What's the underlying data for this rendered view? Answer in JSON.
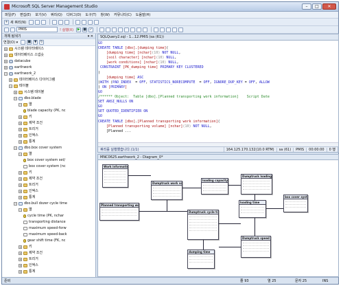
{
  "window": {
    "title": "Microsoft SQL Server Management Studio"
  },
  "menu": [
    "파일(F)",
    "편집(E)",
    "보기(V)",
    "쿼리(Q)",
    "디버그(D)",
    "도구(T)",
    "창(W)",
    "커뮤니티(C)",
    "도움말(H)"
  ],
  "toolbar1": {
    "new_query": "새 쿼리(N)"
  },
  "toolbar2": {
    "database": "PMIS",
    "execute": "! 실행(X)"
  },
  "object_explorer": {
    "title": "개체 탐색기",
    "connect": "연결(O) ▾",
    "tree": [
      {
        "label": "시스템 데이터베이스",
        "depth": 1,
        "icon": "folder"
      },
      {
        "label": "데이터베이스 스냅숏",
        "depth": 1,
        "icon": "folder"
      },
      {
        "label": "datacube",
        "depth": 1,
        "icon": "db"
      },
      {
        "label": "earthwork",
        "depth": 1,
        "icon": "db"
      },
      {
        "label": "earthwork_2",
        "depth": 1,
        "icon": "db"
      },
      {
        "label": "데이터베이스 다이어그램",
        "depth": 2,
        "icon": "folder"
      },
      {
        "label": "테이블",
        "depth": 2,
        "icon": "folder"
      },
      {
        "label": "시스템 테이블",
        "depth": 3,
        "icon": "folder"
      },
      {
        "label": "dbo.blade",
        "depth": 3,
        "icon": "table"
      },
      {
        "label": "열",
        "depth": 4,
        "icon": "folder"
      },
      {
        "label": "blade capacity (PK, nc",
        "depth": 5,
        "icon": "key"
      },
      {
        "label": "키",
        "depth": 4,
        "icon": "folder"
      },
      {
        "label": "제약 조건",
        "depth": 4,
        "icon": "folder"
      },
      {
        "label": "트리거",
        "depth": 4,
        "icon": "folder"
      },
      {
        "label": "인덱스",
        "depth": 4,
        "icon": "folder"
      },
      {
        "label": "통계",
        "depth": 4,
        "icon": "folder"
      },
      {
        "label": "dbo.box cover system",
        "depth": 3,
        "icon": "table"
      },
      {
        "label": "열",
        "depth": 4,
        "icon": "folder"
      },
      {
        "label": "box cover system set/",
        "depth": 5,
        "icon": "key"
      },
      {
        "label": "box cover system (nc",
        "depth": 5,
        "icon": "col"
      },
      {
        "label": "키",
        "depth": 4,
        "icon": "folder"
      },
      {
        "label": "제약 조건",
        "depth": 4,
        "icon": "folder"
      },
      {
        "label": "트리거",
        "depth": 4,
        "icon": "folder"
      },
      {
        "label": "인덱스",
        "depth": 4,
        "icon": "folder"
      },
      {
        "label": "통계",
        "depth": 4,
        "icon": "folder"
      },
      {
        "label": "dbo.bull dozer cycle time",
        "depth": 3,
        "icon": "table"
      },
      {
        "label": "열",
        "depth": 4,
        "icon": "folder"
      },
      {
        "label": "cycle time (PK, nchar",
        "depth": 5,
        "icon": "key"
      },
      {
        "label": "transporting distance",
        "depth": 5,
        "icon": "col"
      },
      {
        "label": "maximum speed-forw",
        "depth": 5,
        "icon": "col"
      },
      {
        "label": "maximum speed-back",
        "depth": 5,
        "icon": "col"
      },
      {
        "label": "gear shift time (FK, nc",
        "depth": 5,
        "icon": "key"
      },
      {
        "label": "키",
        "depth": 4,
        "icon": "folder"
      },
      {
        "label": "제약 조건",
        "depth": 4,
        "icon": "folder"
      },
      {
        "label": "트리거",
        "depth": 4,
        "icon": "folder"
      },
      {
        "label": "인덱스",
        "depth": 4,
        "icon": "folder"
      },
      {
        "label": "통계",
        "depth": 4,
        "icon": "folder"
      }
    ]
  },
  "editor": {
    "tab": "SQLQuery2.sql - 1...12.PMIS (sa (61))",
    "lines": [
      "GO",
      "CREATE TABLE [dbo].[dumping time](",
      "    [dumping time] [nchar](10) NOT NULL,",
      "    [soil character] [nchar](10) NULL,",
      "    [work conditions] [nchar](10) NULL,",
      " CONSTRAINT [PK_dumping time] PRIMARY KEY CLUSTERED",
      "(",
      "    [dumping time] ASC",
      ")WITH (PAD_INDEX  = OFF, STATISTICS_NORECOMPUTE  = OFF, IGNORE_DUP_KEY = OFF, ALLOW",
      ") ON [PRIMARY]",
      "GO",
      "/****** Object:  Table [dbo].[Planned transporting work information]    Script Date",
      "SET ANSI_NULLS ON",
      "GO",
      "SET QUOTED_IDENTIFIER ON",
      "GO",
      "CREATE TABLE [dbo].[Planned transporting work information](",
      "    [Planned transporting volume] [nchar](10) NOT NULL,",
      "    [Planned ..."
    ],
    "status": {
      "msg": "쿼리를 실행했습니다.(1/1)",
      "server": "164.125.170.132(10.0 RTM)",
      "user": "sa (61)",
      "db": "PMIS",
      "time": "00:00:00",
      "rows": "0 행"
    }
  },
  "diagram": {
    "tab": "MNC0625.earthwork_2 - Diagram_0*",
    "tables": [
      {
        "name": "Work information",
        "rows": 5
      },
      {
        "name": "Dumptruck work volume p",
        "rows": 4
      },
      {
        "name": "loading capacity",
        "rows": 3
      },
      {
        "name": "Dumptruck loading c",
        "rows": 4
      },
      {
        "name": "Planned transporting work infor",
        "rows": 3
      },
      {
        "name": "loading time",
        "rows": 3
      },
      {
        "name": "box cover system",
        "rows": 3
      },
      {
        "name": "Dumptruck cycle ti",
        "rows": 6
      },
      {
        "name": "Dumptruck speed",
        "rows": 4
      },
      {
        "name": "dumping time",
        "rows": 3
      }
    ]
  },
  "statusbar": {
    "ready": "준비",
    "line": "줄 93",
    "col": "열 25",
    "ch": "문자 25",
    "ins": "INS"
  }
}
